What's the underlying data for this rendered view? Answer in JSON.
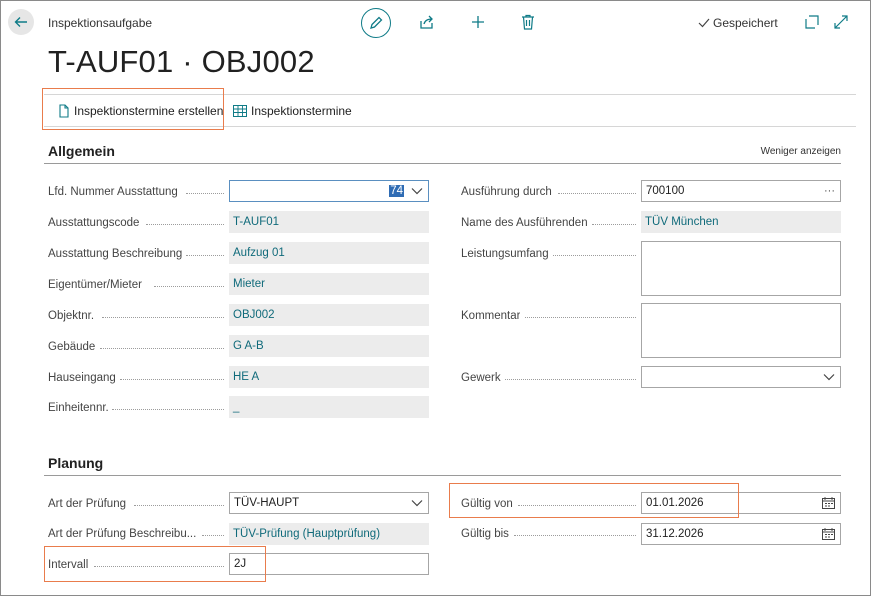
{
  "header": {
    "caption": "Inspektionsaufgabe",
    "title": "T-AUF01 · OBJ002",
    "saved_label": "Gespeichert"
  },
  "actions": [
    {
      "label": "Inspektionstermine erstellen"
    },
    {
      "label": "Inspektionstermine"
    }
  ],
  "general": {
    "title": "Allgemein",
    "toggle_label": "Weniger anzeigen",
    "left": [
      {
        "label": "Lfd. Nummer Ausstattung",
        "value": "74"
      },
      {
        "label": "Ausstattungscode",
        "value": "T-AUF01"
      },
      {
        "label": "Ausstattung Beschreibung",
        "value": "Aufzug 01"
      },
      {
        "label": "Eigentümer/Mieter",
        "value": "Mieter"
      },
      {
        "label": "Objektnr.",
        "value": "OBJ002"
      },
      {
        "label": "Gebäude",
        "value": "G A-B"
      },
      {
        "label": "Hauseingang",
        "value": "HE A"
      },
      {
        "label": "Einheitennr.",
        "value": "_"
      }
    ],
    "right": [
      {
        "label": "Ausführung durch",
        "value": "700100"
      },
      {
        "label": "Name des Ausführenden",
        "value": "TÜV München"
      },
      {
        "label": "Leistungsumfang",
        "value": ""
      },
      {
        "label": "Kommentar",
        "value": ""
      },
      {
        "label": "Gewerk",
        "value": ""
      }
    ]
  },
  "planning": {
    "title": "Planung",
    "left": [
      {
        "label": "Art der Prüfung",
        "value": "TÜV-HAUPT"
      },
      {
        "label": "Art der Prüfung Beschreibu...",
        "value": "TÜV-Prüfung (Hauptprüfung)"
      },
      {
        "label": "Intervall",
        "value": "2J"
      }
    ],
    "right": [
      {
        "label": "Gültig von",
        "value": "01.01.2026"
      },
      {
        "label": "Gültig bis",
        "value": "31.12.2026"
      }
    ]
  },
  "colors": {
    "accent": "#0f7b87",
    "highlight": "#e97c4c",
    "readonly_bg": "#ececec"
  }
}
